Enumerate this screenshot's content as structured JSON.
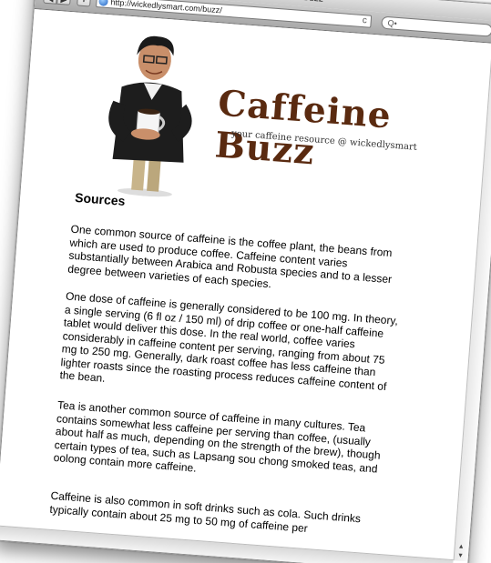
{
  "window": {
    "title": "Head First Caffeine Buzz",
    "url": "http://wickedlysmart.com/buzz/",
    "search_placeholder": "Q•"
  },
  "toolbar": {
    "back_icon": "◀",
    "forward_icon": "▶",
    "add_icon": "+",
    "reload_icon": "c"
  },
  "header": {
    "logo_text": "Caffeine Buzz",
    "tagline": "your caffeine resource @ wickedlysmart"
  },
  "article": {
    "heading": "Sources",
    "paragraphs": [
      "One common source of caffeine is the coffee plant, the beans from which are used to produce coffee. Caffeine content varies substantially between Arabica and Robusta species and to a lesser degree between varieties of each species.",
      "One dose of caffeine is generally considered to be 100 mg. In theory, a single serving (6 fl oz / 150 ml) of drip coffee or one-half caffeine tablet would deliver this dose. In the real world, coffee varies considerably in caffeine content per serving, ranging from about 75 mg to 250 mg. Generally, dark roast coffee has less caffeine than lighter roasts since the roasting process reduces caffeine content of the bean.",
      "Tea is another common source of caffeine in many cultures. Tea contains somewhat less caffeine per serving than coffee, (usually about half as much, depending on the strength of the brew), though certain types of tea, such as Lapsang sou chong smoked teas, and oolong contain more caffeine.",
      "Caffeine is also common in soft drinks such as cola. Such drinks typically contain about 25 mg to 50 mg of caffeine per"
    ]
  },
  "colors": {
    "logo": "#5a2a10",
    "scroll_thumb": "#2f6fc4"
  }
}
